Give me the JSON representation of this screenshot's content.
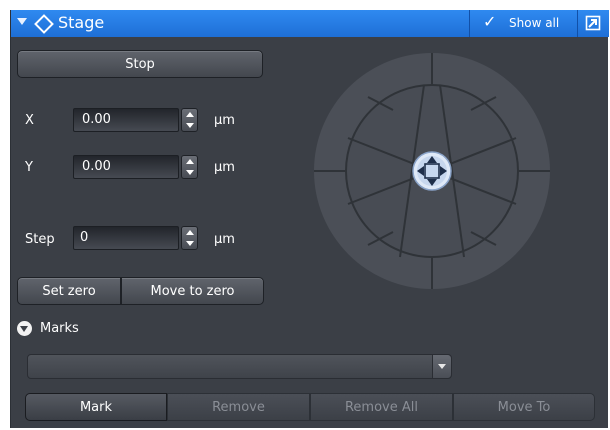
{
  "titlebar": {
    "title": "Stage",
    "expand_icon": "triangle-down-icon",
    "section_icon": "diamond-icon",
    "show_all_check": "✓",
    "show_all_label": "Show all",
    "undock_icon": "undock-icon",
    "accent_color": "#2a84ec"
  },
  "stop_button": "Stop",
  "x": {
    "label": "X",
    "value": "0.00",
    "unit": "µm"
  },
  "y": {
    "label": "Y",
    "value": "0.00",
    "unit": "µm"
  },
  "step": {
    "label": "Step",
    "value": "0",
    "unit": "µm"
  },
  "set_zero_button": "Set zero",
  "move_to_zero_button": "Move to zero",
  "wheel": {
    "icon": "joystick-wheel-icon",
    "center_icon": "four-way-arrow-icon"
  },
  "marks": {
    "label": "Marks",
    "dropdown_value": "",
    "buttons": {
      "mark": "Mark",
      "remove": "Remove",
      "remove_all": "Remove All",
      "move_to": "Move To"
    }
  }
}
